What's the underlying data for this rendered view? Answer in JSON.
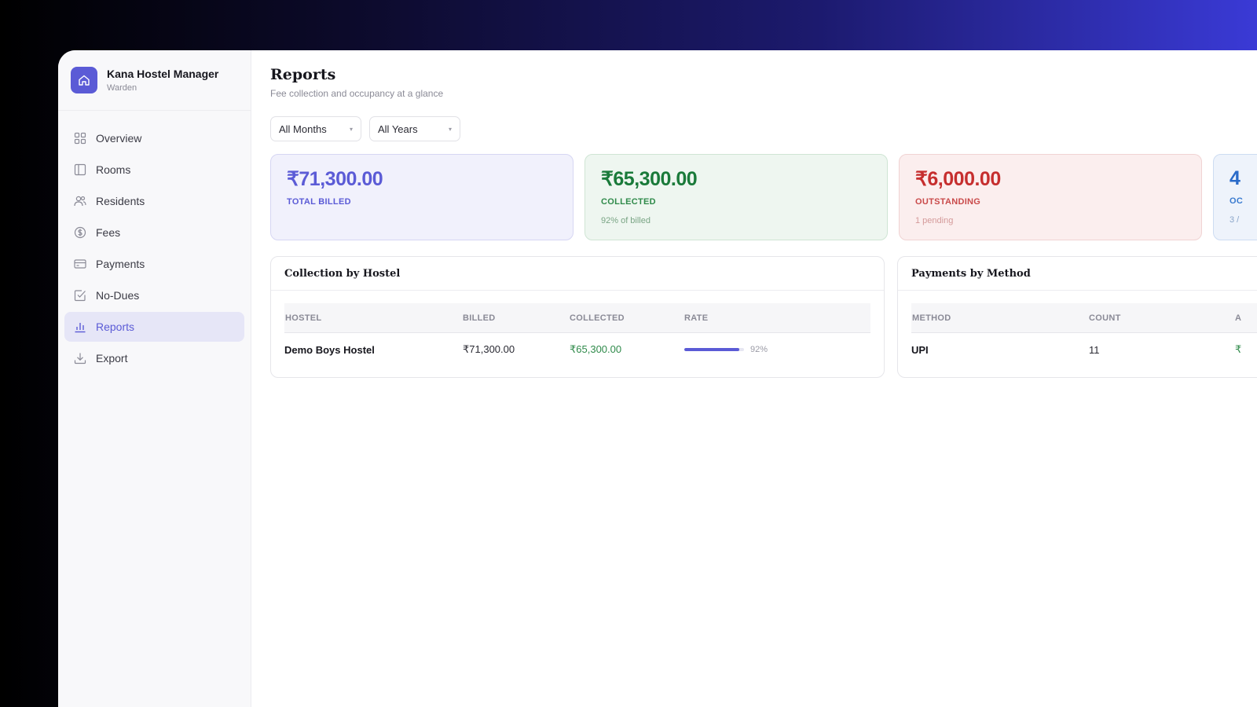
{
  "brand": {
    "name": "Kana Hostel Manager",
    "role": "Warden",
    "accent": "#5b5bd6"
  },
  "nav": [
    {
      "label": "Overview",
      "icon": "grid-icon",
      "active": false
    },
    {
      "label": "Rooms",
      "icon": "door-icon",
      "active": false
    },
    {
      "label": "Residents",
      "icon": "users-icon",
      "active": false
    },
    {
      "label": "Fees",
      "icon": "dollar-icon",
      "active": false
    },
    {
      "label": "Payments",
      "icon": "card-icon",
      "active": false
    },
    {
      "label": "No-Dues",
      "icon": "checkbox-icon",
      "active": false
    },
    {
      "label": "Reports",
      "icon": "bar-chart-icon",
      "active": true
    },
    {
      "label": "Export",
      "icon": "download-icon",
      "active": false
    }
  ],
  "page": {
    "title": "Reports",
    "subtitle": "Fee collection and occupancy at a glance"
  },
  "filters": {
    "month": "All Months",
    "year": "All Years"
  },
  "cards": {
    "billed": {
      "amount": "₹71,300.00",
      "label": "TOTAL BILLED"
    },
    "collected": {
      "amount": "₹65,300.00",
      "label": "COLLECTED",
      "note": "92% of billed"
    },
    "outstanding": {
      "amount": "₹6,000.00",
      "label": "OUTSTANDING",
      "note": "1 pending"
    },
    "occupancy": {
      "amount": "4",
      "label": "OC",
      "note": "3 /"
    }
  },
  "collection_by_hostel": {
    "title": "Collection by Hostel",
    "headers": [
      "HOSTEL",
      "BILLED",
      "COLLECTED",
      "RATE"
    ],
    "rows": [
      {
        "hostel": "Demo Boys Hostel",
        "billed": "₹71,300.00",
        "collected": "₹65,300.00",
        "rate": "92%",
        "rate_value": 92
      }
    ]
  },
  "payments_by_method": {
    "title": "Payments by Method",
    "headers": [
      "METHOD",
      "COUNT",
      "A"
    ],
    "rows": [
      {
        "method": "UPI",
        "count": "11",
        "amount": "₹"
      }
    ]
  }
}
